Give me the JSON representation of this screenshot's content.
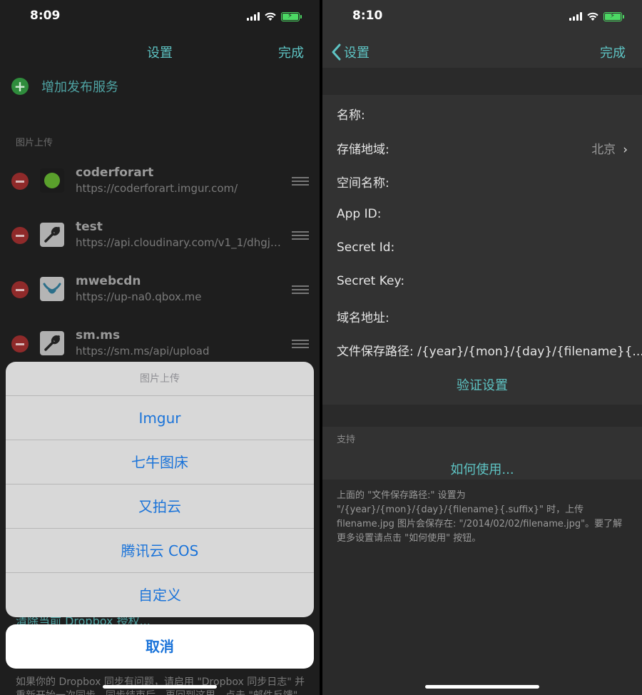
{
  "left": {
    "status_time": "8:09",
    "nav_title": "设置",
    "nav_done": "完成",
    "add_service": "增加发布服务",
    "section_header": "图片上传",
    "services": [
      {
        "name": "coderforart",
        "url": "https://coderforart.imgur.com/",
        "icon": "green-dot-icon"
      },
      {
        "name": "test",
        "url": "https://api.cloudinary.com/v1_1/dhgj8...",
        "icon": "wrench-icon"
      },
      {
        "name": "mwebcdn",
        "url": "https://up-na0.qbox.me",
        "icon": "qiniu-bull-icon"
      },
      {
        "name": "sm.ms",
        "url": "https://sm.ms/api/upload",
        "icon": "wrench-icon"
      }
    ],
    "under_text_1": "清除当前 Dropbox 授权...",
    "under_text_2": "如果你的 Dropbox 同步有问题，请启用 \"Dropbox 同步日志\" 并",
    "under_text_3": "重新开始一次同步，同步结束后，再回到这里，点击 \"邮件反馈\"",
    "action_sheet": {
      "title": "图片上传",
      "items": [
        "Imgur",
        "七牛图床",
        "又拍云",
        "腾讯云 COS",
        "自定义"
      ],
      "cancel": "取消"
    }
  },
  "right": {
    "status_time": "8:10",
    "back_label": "设置",
    "nav_done": "完成",
    "fields": {
      "name": "名称:",
      "region": "存储地域:",
      "region_value": "北京",
      "space": "空间名称:",
      "app_id": "App ID:",
      "secret_id": "Secret Id:",
      "secret_key": "Secret Key:",
      "domain": "域名地址:",
      "path": "文件保存路径:  /{year}/{mon}/{day}/{filename}{...."
    },
    "verify": "验证设置",
    "support_header": "支持",
    "how_to": "如何使用...",
    "footer_note": "上面的 \"文件保存路径:\" 设置为 \"/{year}/{mon}/{day}/{filename}{.suffix}\" 时，上传 filename.jpg 图片会保存在: \"/2014/02/02/filename.jpg\"。要了解更多设置请点击 \"如何使用\" 按钮。"
  },
  "colors": {
    "accent_teal": "#5ec4c4",
    "ios_blue": "#1a73d9",
    "battery_green": "#4cd964",
    "delete_red": "#8f2a2a",
    "add_green": "#2f8c3c"
  }
}
